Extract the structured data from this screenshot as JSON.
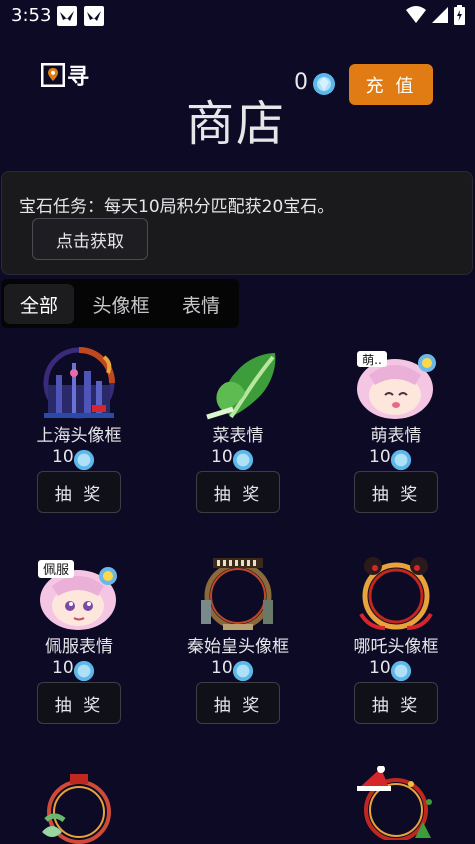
{
  "status_bar": {
    "time": "3:53"
  },
  "header": {
    "logo_text": "寻",
    "title": "商店",
    "gem_count": "0",
    "recharge_label": "充 值"
  },
  "task": {
    "text": "宝石任务：每天10局积分匹配获20宝石。",
    "button_label": "点击获取"
  },
  "tabs": [
    {
      "label": "全部",
      "active": true
    },
    {
      "label": "头像框",
      "active": false
    },
    {
      "label": "表情",
      "active": false
    }
  ],
  "items": [
    {
      "name": "上海头像框",
      "price": "10",
      "button": "抽 奖",
      "icon": "shanghai-frame-icon"
    },
    {
      "name": "菜表情",
      "price": "10",
      "button": "抽 奖",
      "icon": "vegetable-sticker-icon"
    },
    {
      "name": "萌表情",
      "price": "10",
      "button": "抽 奖",
      "icon": "cute-sticker-icon",
      "sticker_text": "萌.."
    },
    {
      "name": "佩服表情",
      "price": "10",
      "button": "抽 奖",
      "icon": "admire-sticker-icon",
      "sticker_text": "佩服"
    },
    {
      "name": "秦始皇头像框",
      "price": "10",
      "button": "抽 奖",
      "icon": "qinshihuang-frame-icon"
    },
    {
      "name": "哪吒头像框",
      "price": "10",
      "button": "抽 奖",
      "icon": "nezha-frame-icon"
    }
  ],
  "colors": {
    "background": "#0c0a24",
    "accent": "#e07c13",
    "gem": "#6ec6f0"
  }
}
